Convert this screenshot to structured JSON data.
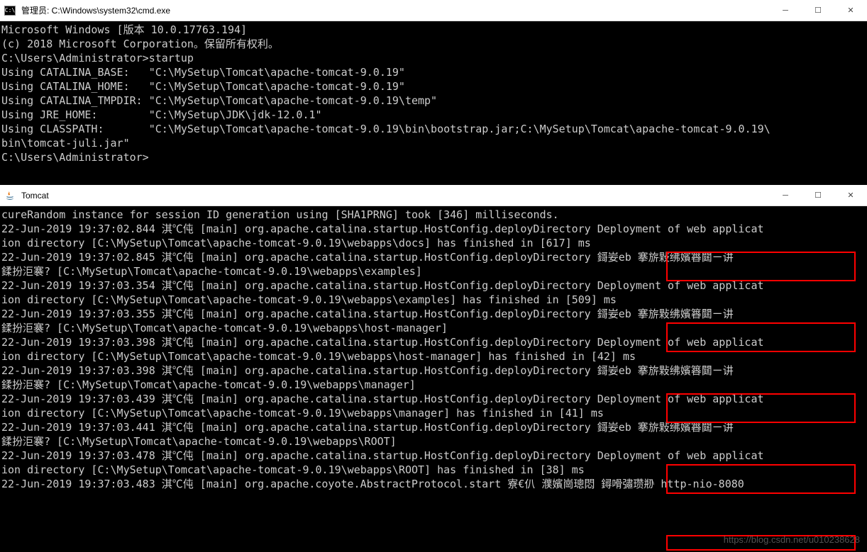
{
  "window1": {
    "title": "管理员: C:\\Windows\\system32\\cmd.exe",
    "lines": [
      "Microsoft Windows [版本 10.0.17763.194]",
      "(c) 2018 Microsoft Corporation。保留所有权利。",
      "",
      "C:\\Users\\Administrator>startup",
      "Using CATALINA_BASE:   \"C:\\MySetup\\Tomcat\\apache-tomcat-9.0.19\"",
      "Using CATALINA_HOME:   \"C:\\MySetup\\Tomcat\\apache-tomcat-9.0.19\"",
      "Using CATALINA_TMPDIR: \"C:\\MySetup\\Tomcat\\apache-tomcat-9.0.19\\temp\"",
      "Using JRE_HOME:        \"C:\\MySetup\\JDK\\jdk-12.0.1\"",
      "Using CLASSPATH:       \"C:\\MySetup\\Tomcat\\apache-tomcat-9.0.19\\bin\\bootstrap.jar;C:\\MySetup\\Tomcat\\apache-tomcat-9.0.19\\",
      "bin\\tomcat-juli.jar\"",
      "C:\\Users\\Administrator>"
    ]
  },
  "window2": {
    "title": "Tomcat",
    "lines": [
      "cureRandom instance for session ID generation using [SHA1PRNG] took [346] milliseconds.",
      "22-Jun-2019 19:37:02.844 淇℃伅 [main] org.apache.catalina.startup.HostConfig.deployDirectory Deployment of web applicat",
      "ion directory [C:\\MySetup\\Tomcat\\apache-tomcat-9.0.19\\webapps\\docs] has finished in [617] ms",
      "22-Jun-2019 19:37:02.845 淇℃伅 [main] org.apache.catalina.startup.HostConfig.deployDirectory 鎶妛eb 搴旂敤绋嬪簭閮ㄧ讲",
      "鍒扮洰褰? [C:\\MySetup\\Tomcat\\apache-tomcat-9.0.19\\webapps\\examples]",
      "",
      "22-Jun-2019 19:37:03.354 淇℃伅 [main] org.apache.catalina.startup.HostConfig.deployDirectory Deployment of web applicat",
      "ion directory [C:\\MySetup\\Tomcat\\apache-tomcat-9.0.19\\webapps\\examples] has finished in [509] ms",
      "22-Jun-2019 19:37:03.355 淇℃伅 [main] org.apache.catalina.startup.HostConfig.deployDirectory 鎶妛eb 搴旂敤绋嬪簭閮ㄧ讲",
      "鍒扮洰褰? [C:\\MySetup\\Tomcat\\apache-tomcat-9.0.19\\webapps\\host-manager]",
      "",
      "22-Jun-2019 19:37:03.398 淇℃伅 [main] org.apache.catalina.startup.HostConfig.deployDirectory Deployment of web applicat",
      "ion directory [C:\\MySetup\\Tomcat\\apache-tomcat-9.0.19\\webapps\\host-manager] has finished in [42] ms",
      "22-Jun-2019 19:37:03.398 淇℃伅 [main] org.apache.catalina.startup.HostConfig.deployDirectory 鎶妛eb 搴旂敤绋嬪簭閮ㄧ讲",
      "鍒扮洰褰? [C:\\MySetup\\Tomcat\\apache-tomcat-9.0.19\\webapps\\manager]",
      "",
      "22-Jun-2019 19:37:03.439 淇℃伅 [main] org.apache.catalina.startup.HostConfig.deployDirectory Deployment of web applicat",
      "ion directory [C:\\MySetup\\Tomcat\\apache-tomcat-9.0.19\\webapps\\manager] has finished in [41] ms",
      "22-Jun-2019 19:37:03.441 淇℃伅 [main] org.apache.catalina.startup.HostConfig.deployDirectory 鎶妛eb 搴旂敤绋嬪簭閮ㄧ讲",
      "鍒扮洰褰? [C:\\MySetup\\Tomcat\\apache-tomcat-9.0.19\\webapps\\ROOT]",
      "",
      "22-Jun-2019 19:37:03.478 淇℃伅 [main] org.apache.catalina.startup.HostConfig.deployDirectory Deployment of web applicat",
      "ion directory [C:\\MySetup\\Tomcat\\apache-tomcat-9.0.19\\webapps\\ROOT] has finished in [38] ms",
      "22-Jun-2019 19:37:03.483 淇℃伅 [main] org.apache.coyote.AbstractProtocol.start 寮€仈 濮嬪崗璁悶 鐞嗗彇瓒剙 http-nio-8080"
    ]
  },
  "watermark": "https://blog.csdn.net/u010238628",
  "glyphs": {
    "minimize": "─",
    "maximize": "☐",
    "close": "✕"
  }
}
